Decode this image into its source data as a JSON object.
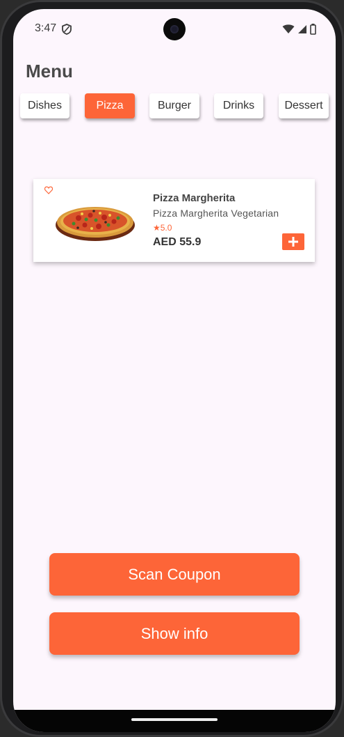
{
  "status_bar": {
    "time": "3:47"
  },
  "header": {
    "title": "Menu"
  },
  "categories": [
    {
      "label": "Dishes",
      "active": false
    },
    {
      "label": "Pizza",
      "active": true
    },
    {
      "label": "Burger",
      "active": false
    },
    {
      "label": "Drinks",
      "active": false
    },
    {
      "label": "Dessert",
      "active": false
    }
  ],
  "item": {
    "name": "Pizza Margherita",
    "description": "Pizza Margherita Vegetarian",
    "rating": "★5.0",
    "price": "AED 55.9",
    "favorite_icon": "heart-outline-icon",
    "add_icon": "plus-icon"
  },
  "actions": {
    "scan_label": "Scan Coupon",
    "info_label": "Show info"
  },
  "colors": {
    "accent": "#fd6538",
    "background": "#fdf6fd"
  }
}
